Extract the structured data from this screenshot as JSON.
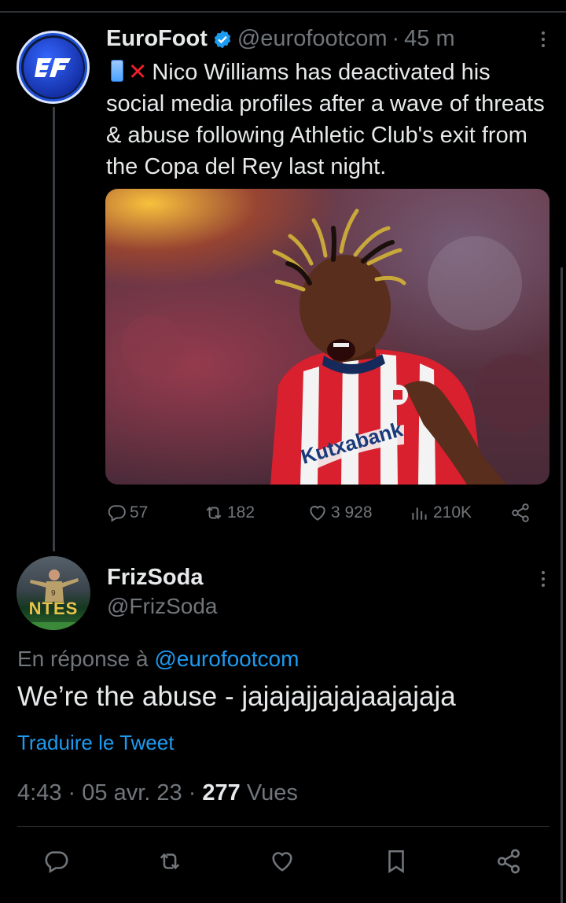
{
  "main_tweet": {
    "author_name": "EuroFoot",
    "author_handle": "@eurofootcom",
    "separator": "·",
    "time_ago": "45 m",
    "text": "Nico Williams has deactivated his social media profiles after a wave of threats & abuse following Athletic Club's exit from the Copa del Rey last night.",
    "media_jersey_sponsor": "Kutxabank",
    "stats": {
      "replies": "57",
      "retweets": "182",
      "likes": "3 928",
      "views": "210K"
    }
  },
  "reply_tweet": {
    "author_name": "FrizSoda",
    "author_handle": "@FrizSoda",
    "avatar_text": "NTES",
    "reply_prefix": "En réponse à",
    "reply_to_handle": "@eurofootcom",
    "text": "We’re the abuse - jajajajjajajaajajaja",
    "translate_label": "Traduire le Tweet",
    "time": "4:43",
    "date": "05 avr. 23",
    "views_count": "277",
    "views_label": "Vues",
    "separator": "·"
  },
  "icons": {
    "verified": "verified-badge-icon",
    "more": "more-options-icon",
    "reply": "reply-icon",
    "retweet": "retweet-icon",
    "like": "heart-icon",
    "views": "views-chart-icon",
    "share": "share-icon",
    "bookmark": "bookmark-icon"
  },
  "colors": {
    "background": "#000000",
    "text": "#e7e9ea",
    "muted": "#71767b",
    "accent": "#1d9bf0"
  }
}
